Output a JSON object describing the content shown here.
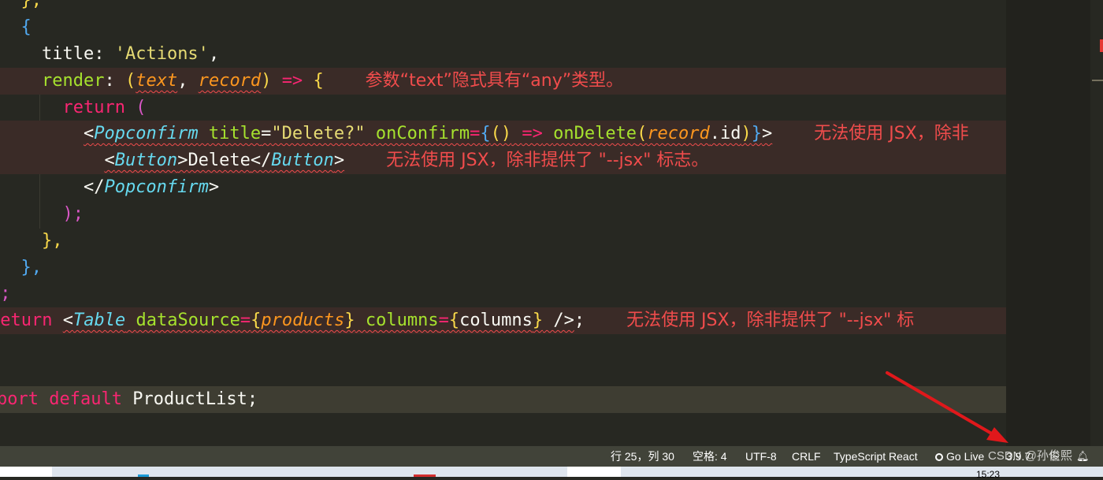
{
  "editor": {
    "l0": "},",
    "l1": "{",
    "l2": {
      "title": "title",
      "colon": ": ",
      "value": "'Actions'",
      "comma": ","
    },
    "l3": {
      "render": "render",
      "colon": ": ",
      "text": "text",
      "record": "record",
      "arrow": "=>",
      "diag": "参数“text”隐式具有“any”类型。"
    },
    "l4": {
      "kw": "return",
      "paren": "("
    },
    "l5": {
      "lt": "<",
      "tag": "Popconfirm",
      "attr1": "title",
      "val1": "\"Delete?\"",
      "attr2": "onConfirm",
      "fn": "onDelete",
      "rec": "record",
      "id": ".id",
      "diag": "无法使用 JSX，除非"
    },
    "l6": {
      "tag": "Button",
      "text": "Delete",
      "diag": "无法使用 JSX，除非提供了 \"--jsx\" 标志。"
    },
    "l7": {
      "tag": "Popconfirm"
    },
    "l8": ");",
    "l9": "},",
    "l10": "},",
    "l11": "];",
    "l12": {
      "kw": "return",
      "tag": "Table",
      "attr1": "dataSource",
      "var1": "products",
      "attr2": "columns",
      "var2": "columns",
      "diag": "无法使用 JSX，除非提供了 \"--jsx\" 标"
    },
    "l13": {
      "kw1": "port",
      "kw2": "default",
      "name": "ProductList",
      "semi": ";"
    }
  },
  "status": {
    "position": "行 25，列 30",
    "spaces": "空格: 4",
    "encoding": "UTF-8",
    "eol": "CRLF",
    "language": "TypeScript React",
    "golive": "Go Live",
    "version": "3.9.7"
  },
  "watermark": "CSDN @孙俊熙",
  "taskbar_time": "15:23"
}
